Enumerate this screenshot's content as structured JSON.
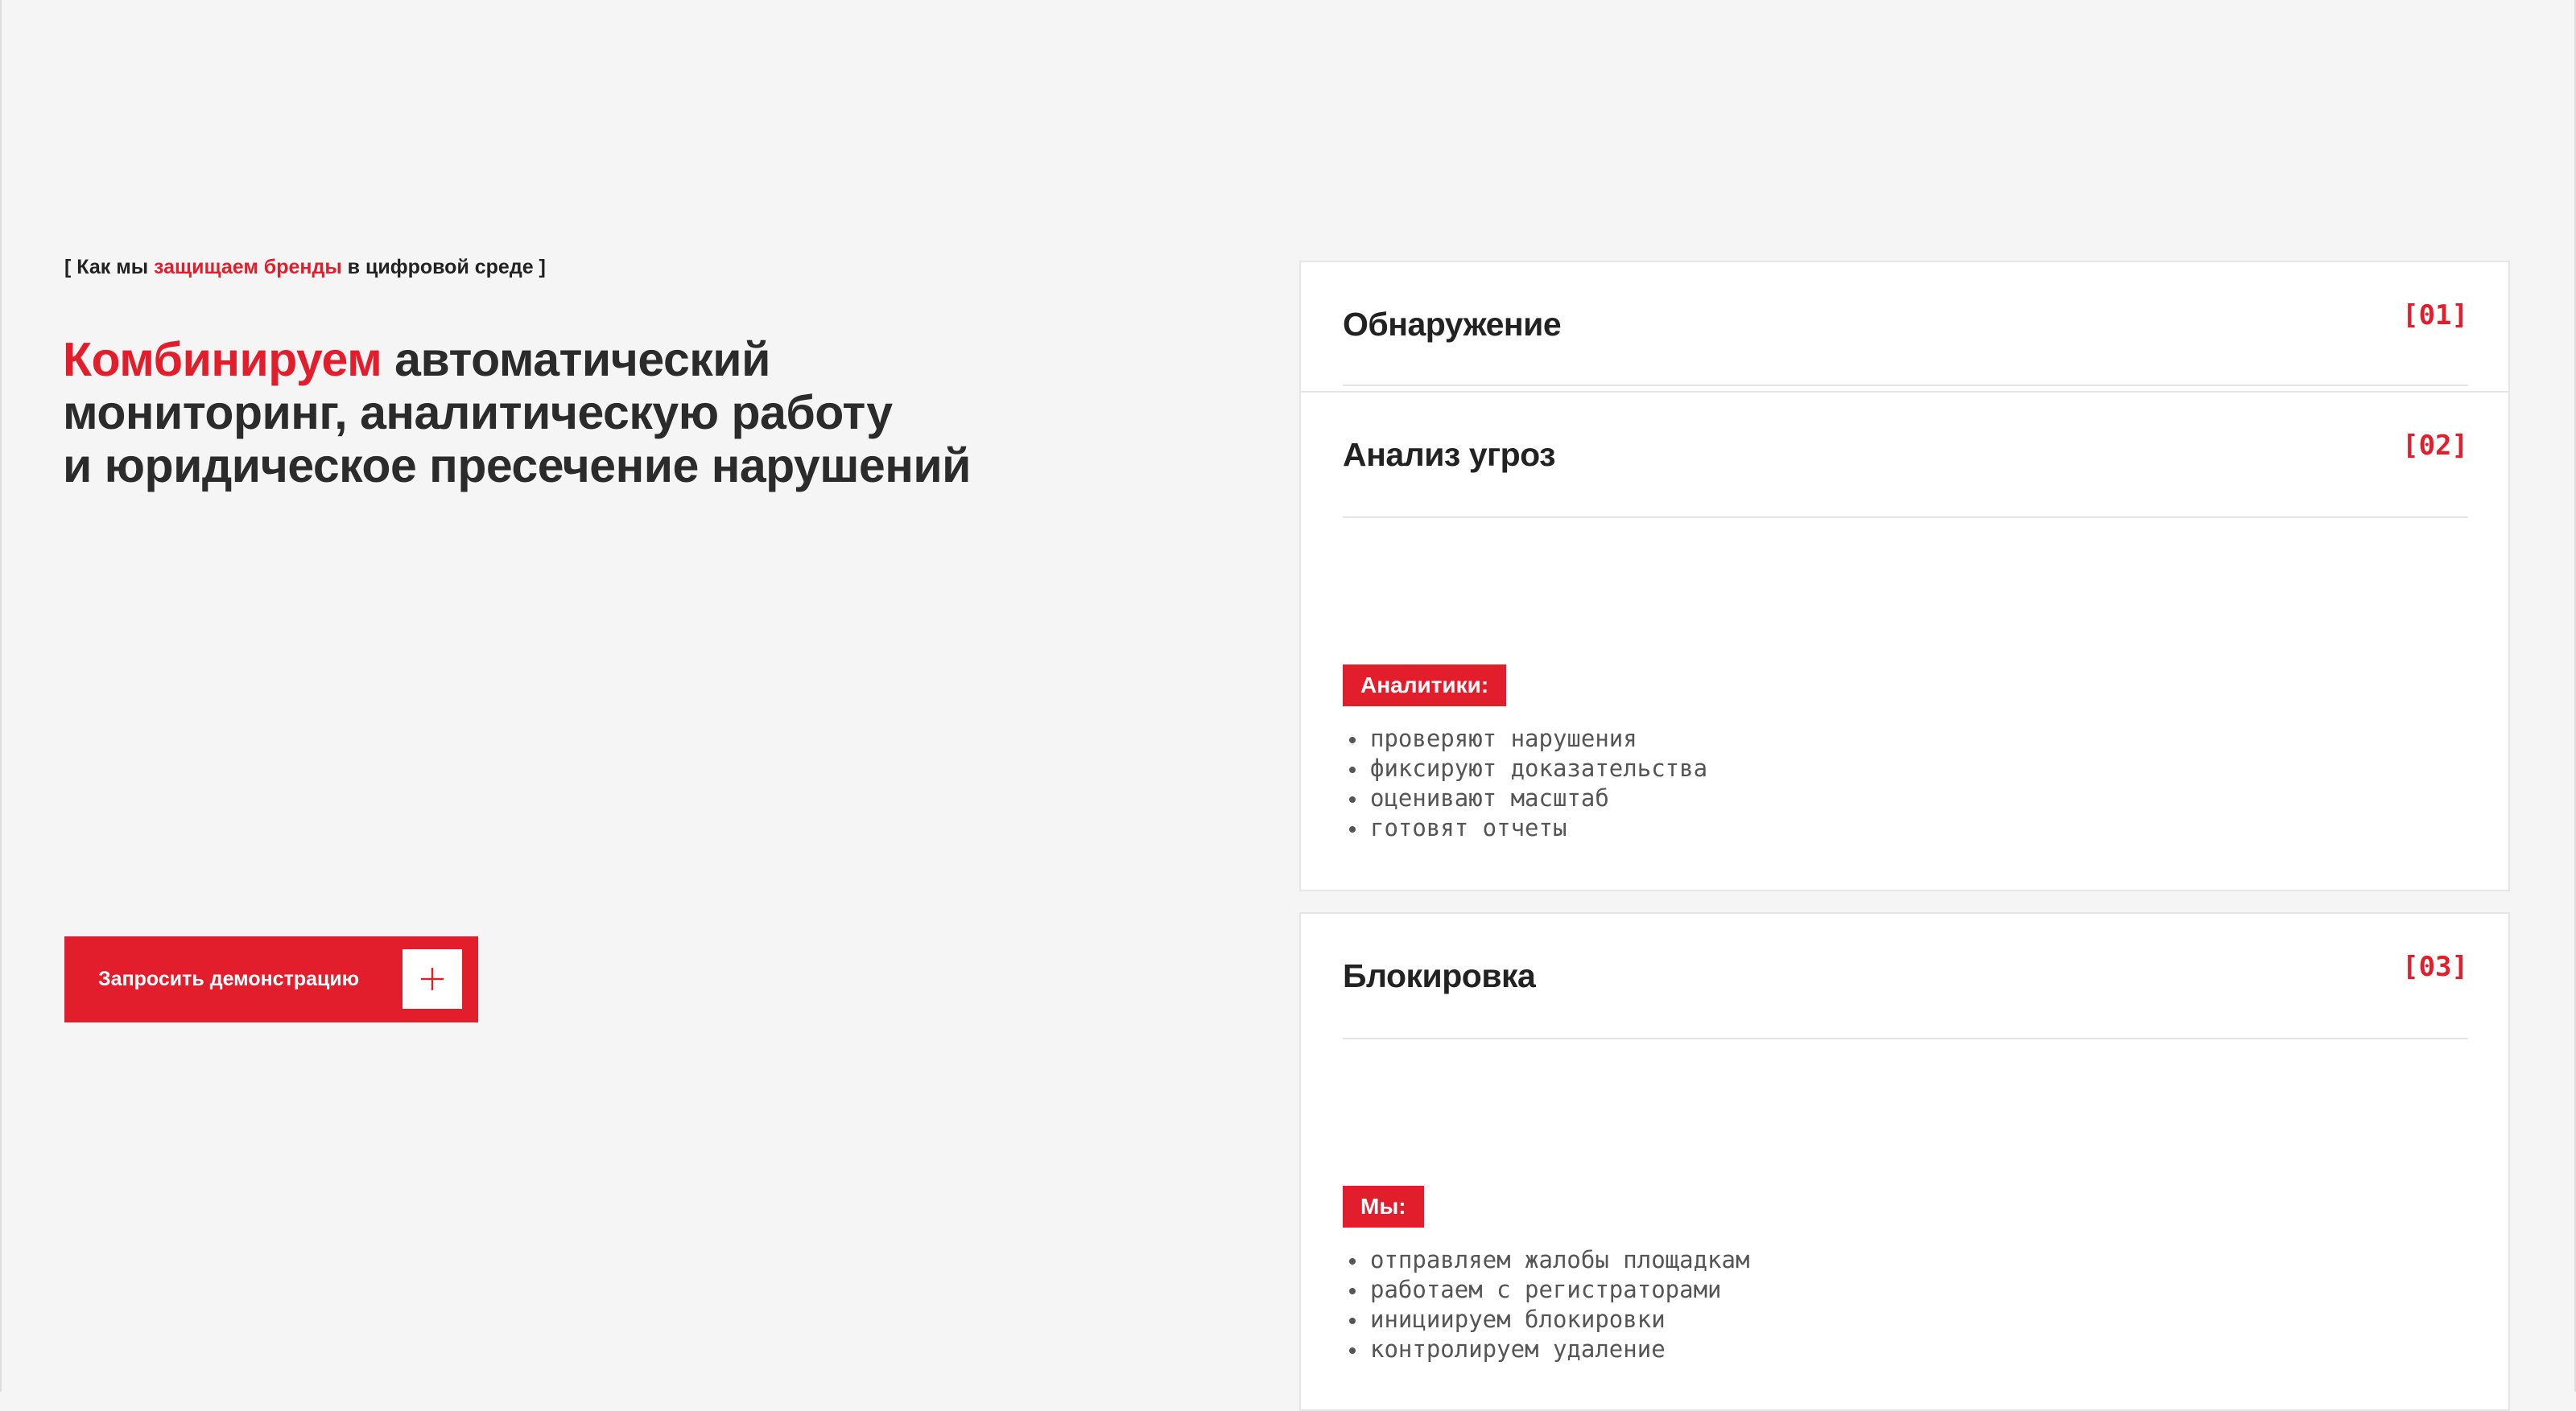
{
  "hero": {
    "kicker_prefix": "[ Как мы ",
    "kicker_accent": "защищаем бренды",
    "kicker_suffix": " в цифровой среде ]",
    "headline_accent": "Комбинируем",
    "headline_line1_rest": " автоматический",
    "headline_line2": "мониторинг, аналитическую работу",
    "headline_line3": "и юридическое пресечение нарушений",
    "cta_label": "Запросить демонстрацию",
    "cta_icon": "plus-icon"
  },
  "steps": [
    {
      "title": "Обнаружение",
      "number": "[01]"
    },
    {
      "title": "Анализ угроз",
      "number": "[02]",
      "badge": "Аналитики:",
      "items": [
        "проверяют нарушения",
        "фиксируют доказательства",
        "оценивают масштаб",
        "готовят отчеты"
      ]
    },
    {
      "title": "Блокировка",
      "number": "[03]",
      "badge": "Мы:",
      "items": [
        "отправляем жалобы площадкам",
        "работаем с регистраторами",
        "инициируем блокировки",
        "контролируем удаление"
      ]
    }
  ],
  "colors": {
    "accent": "#e31e2c",
    "background": "#f5f5f5",
    "text": "#222222"
  }
}
